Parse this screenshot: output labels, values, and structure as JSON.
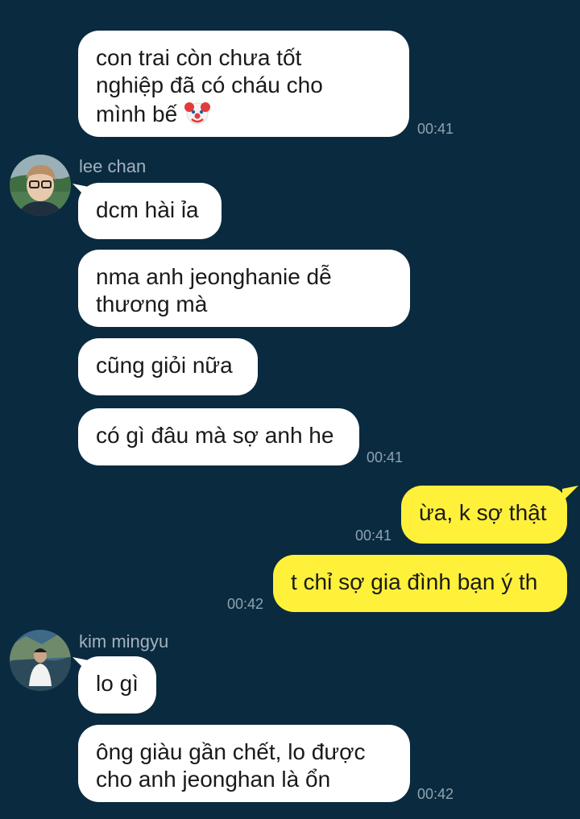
{
  "messages": {
    "m1": {
      "line1": "con trai còn chưa tốt",
      "line2": "nghiệp đã có cháu cho",
      "line3": "mình bế",
      "emoji": "clown-face-icon",
      "time": "00:41"
    },
    "user1": {
      "name": "lee chan"
    },
    "m2": {
      "text": "dcm hài ỉa"
    },
    "m3": {
      "line1": "nma anh jeonghanie dễ",
      "line2": "thương mà"
    },
    "m4": {
      "text": "cũng giỏi nữa"
    },
    "m5": {
      "text": "có gì đâu mà sợ anh he",
      "time": "00:41"
    },
    "m6": {
      "text": "ừa, k sợ thật",
      "time": "00:41"
    },
    "m7": {
      "text": "t chỉ sợ gia đình bạn ý th",
      "time": "00:42"
    },
    "user2": {
      "name": "kim mingyu"
    },
    "m8": {
      "text": "lo gì"
    },
    "m9": {
      "line1": "ông giàu gần chết, lo được",
      "line2": "cho anh jeonghan là ổn",
      "time": "00:42"
    }
  },
  "colors": {
    "background": "#0a2a3f",
    "incoming_bubble": "#ffffff",
    "outgoing_bubble": "#fff13a",
    "timestamp": "#8fa3b1"
  }
}
